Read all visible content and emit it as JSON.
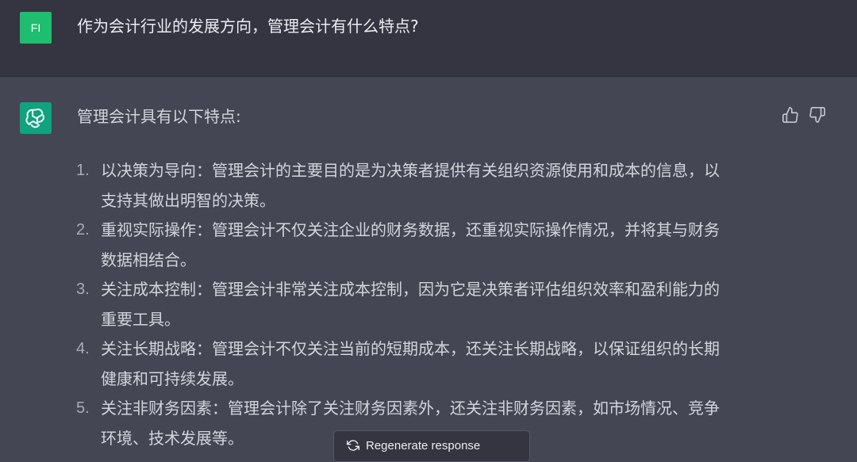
{
  "user": {
    "avatar_initials": "FI",
    "message": "作为会计行业的发展方向，管理会计有什么特点?"
  },
  "assistant": {
    "avatar_icon": "openai-logo-icon",
    "intro": "管理会计具有以下特点:",
    "items": [
      {
        "number": "1.",
        "text": "以决策为导向：管理会计的主要目的是为决策者提供有关组织资源使用和成本的信息，以",
        "text2": "支持其做出明智的决策。"
      },
      {
        "number": "2.",
        "text": "重视实际操作：管理会计不仅关注企业的财务数据，还重视实际操作情况，并将其与财务",
        "text2": "数据相结合。"
      },
      {
        "number": "3.",
        "text": "关注成本控制：管理会计非常关注成本控制，因为它是决策者评估组织效率和盈利能力的",
        "text2": "重要工具。"
      },
      {
        "number": "4.",
        "text": "关注长期战略：管理会计不仅关注当前的短期成本，还关注长期战略，以保证组织的长期",
        "text2": "健康和可持续发展。"
      },
      {
        "number": "5.",
        "text": "关注非财务因素：管理会计除了关注财务因素外，还关注非财务因素，如市场情况、竞争",
        "text2": "环境、技术发展等。"
      }
    ],
    "feedback": {
      "up_icon": "thumbs-up-icon",
      "down_icon": "thumbs-down-icon"
    }
  },
  "regenerate": {
    "label": "Regenerate response"
  },
  "colors": {
    "user_bg": "#343541",
    "assistant_bg": "#444654",
    "user_avatar": "#1fbd6f",
    "bot_avatar": "#10a37f"
  }
}
